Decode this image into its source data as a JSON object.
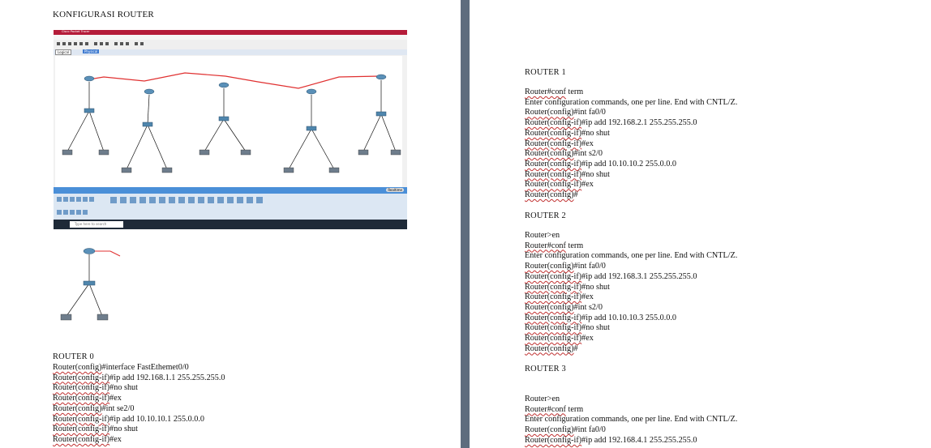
{
  "left_page": {
    "title": "KONFIGURASI ROUTER",
    "screenshot": {
      "window_title": "Cisco Packet Tracer",
      "tab_logical": "Logical",
      "tab_physical": "Physical",
      "realtime_label": "Realtime",
      "simulation_label": "Simulation",
      "search_placeholder": "Type here to search"
    },
    "router0": {
      "heading": "ROUTER 0",
      "lines": [
        {
          "pre": "Router(config)",
          "post": "#interface FastEthemet0/0"
        },
        {
          "pre": "Router(config-if)",
          "post": "#ip add 192.168.1.1 255.255.255.0"
        },
        {
          "pre": "Router(config-if)",
          "post": "#no shut"
        },
        {
          "pre": "Router(config-if)",
          "post": "#ex"
        },
        {
          "pre": "Router(config)",
          "post": "#int se2/0"
        },
        {
          "pre": "Router(config-if)",
          "post": "#ip add 10.10.10.1 255.0.0.0"
        },
        {
          "pre": "Router(config-if)",
          "post": "#no shut"
        },
        {
          "pre": "Router(config-if)",
          "post": "#ex"
        }
      ]
    }
  },
  "right_page": {
    "router1": {
      "heading": "ROUTER 1",
      "lines": [
        {
          "pre": "Router#conf",
          "post": " term"
        },
        {
          "pre": "",
          "post": "Enter configuration commands, one per line. End with CNTL/Z."
        },
        {
          "pre": "Router(config)",
          "post": "#int fa0/0"
        },
        {
          "pre": "Router(config-if)",
          "post": "#ip add 192.168.2.1 255.255.255.0"
        },
        {
          "pre": "Router(config-if)",
          "post": "#no shut"
        },
        {
          "pre": "Router(config-if)",
          "post": "#ex"
        },
        {
          "pre": "Router(config)",
          "post": "#int s2/0"
        },
        {
          "pre": "Router(config-if)",
          "post": "#ip add 10.10.10.2 255.0.0.0"
        },
        {
          "pre": "Router(config-if)",
          "post": "#no shut"
        },
        {
          "pre": "Router(config-if)",
          "post": "#ex"
        },
        {
          "pre": "Router(config)",
          "post": "#"
        }
      ]
    },
    "router2": {
      "heading": "ROUTER 2",
      "lines": [
        {
          "pre": "",
          "post": "Router>en"
        },
        {
          "pre": "Router#conf",
          "post": " term"
        },
        {
          "pre": "",
          "post": "Enter configuration commands, one per line. End with CNTL/Z."
        },
        {
          "pre": "Router(config)",
          "post": "#int fa0/0"
        },
        {
          "pre": "Router(config-if)",
          "post": "#ip add 192.168.3.1 255.255.255.0"
        },
        {
          "pre": "Router(config-if)",
          "post": "#no shut"
        },
        {
          "pre": "Router(config-if)",
          "post": "#ex"
        },
        {
          "pre": "Router(config)",
          "post": "#int s2/0"
        },
        {
          "pre": "Router(config-if)",
          "post": "#ip add 10.10.10.3 255.0.0.0"
        },
        {
          "pre": "Router(config-if)",
          "post": "#no shut"
        },
        {
          "pre": "Router(config-if)",
          "post": "#ex"
        },
        {
          "pre": "Router(config)",
          "post": "#"
        }
      ]
    },
    "router3": {
      "heading": "ROUTER 3",
      "lines": [
        {
          "pre": "",
          "post": "Router>en"
        },
        {
          "pre": "Router#conf",
          "post": " term"
        },
        {
          "pre": "",
          "post": "Enter configuration commands, one per line. End with CNTL/Z."
        },
        {
          "pre": "Router(config)",
          "post": "#int fa0/0"
        },
        {
          "pre": "Router(config-if)",
          "post": "#ip add 192.168.4.1 255.255.255.0"
        }
      ]
    }
  }
}
